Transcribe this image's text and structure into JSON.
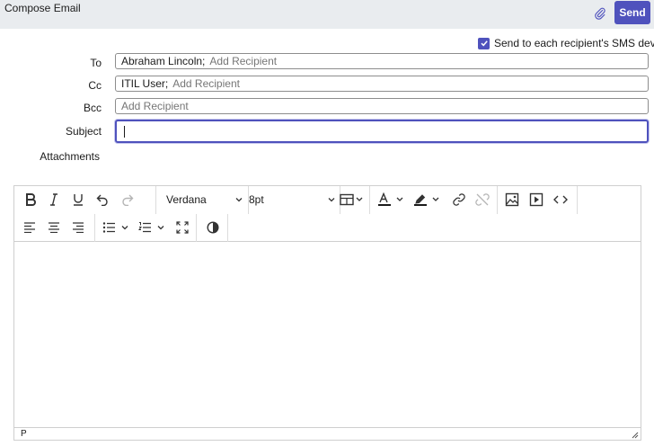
{
  "header": {
    "title": "Compose Email",
    "send_label": "Send"
  },
  "sms": {
    "label": "Send to each recipient's SMS device",
    "checked": true
  },
  "fields": {
    "to_label": "To",
    "to_recipient": "Abraham Lincoln;",
    "cc_label": "Cc",
    "cc_recipient": "ITIL User;",
    "bcc_label": "Bcc",
    "add_recipient_placeholder": "Add Recipient",
    "subject_label": "Subject",
    "subject_value": "",
    "attachments_label": "Attachments"
  },
  "editor": {
    "font_family": "Verdana",
    "font_size": "8pt",
    "status_path": "P"
  },
  "colors": {
    "accent": "#4f52bd",
    "header_bg": "#e9ecef"
  }
}
